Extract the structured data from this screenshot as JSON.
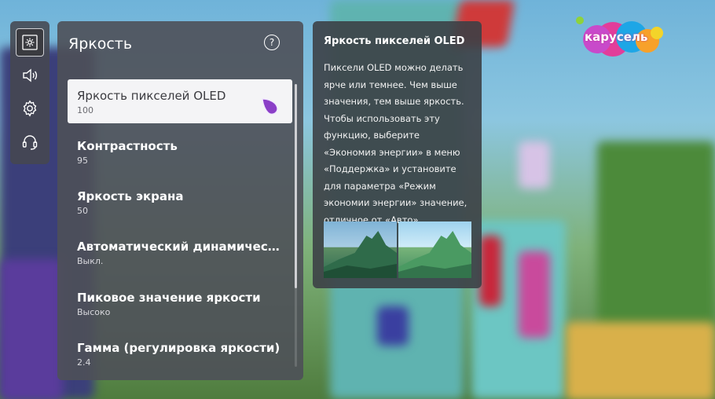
{
  "sidebar": {
    "items": [
      {
        "icon": "picture-settings-icon",
        "active": true
      },
      {
        "icon": "sound-icon",
        "active": false
      },
      {
        "icon": "gear-icon",
        "active": false
      },
      {
        "icon": "support-headset-icon",
        "active": false
      }
    ]
  },
  "panel": {
    "title": "Яркость",
    "help_icon": "help-icon",
    "items": [
      {
        "label": "Яркость пикселей OLED",
        "value": "100"
      },
      {
        "label": "Контрастность",
        "value": "95"
      },
      {
        "label": "Яркость экрана",
        "value": "50"
      },
      {
        "label": "Автоматический динамический ...",
        "value": "Выкл."
      },
      {
        "label": "Пиковое значение яркости",
        "value": "Высоко"
      },
      {
        "label": "Гамма (регулировка яркости)",
        "value": "2.4"
      }
    ]
  },
  "info": {
    "title": "Яркость пикселей OLED",
    "text": "Пиксели OLED можно делать ярче или темнее. Чем выше значения, тем выше яркость. Чтобы использовать эту функцию, выберите «Экономия энергии» в меню «Поддержка» и установите для параметра «Режим экономии энергии» значение, отличное от «Авто»."
  },
  "logo": {
    "text": "карусель"
  },
  "colors": {
    "selected_bg": "#f4f4f6",
    "panel_bg": "#4e5058",
    "pointer": "#8b3fc7"
  }
}
